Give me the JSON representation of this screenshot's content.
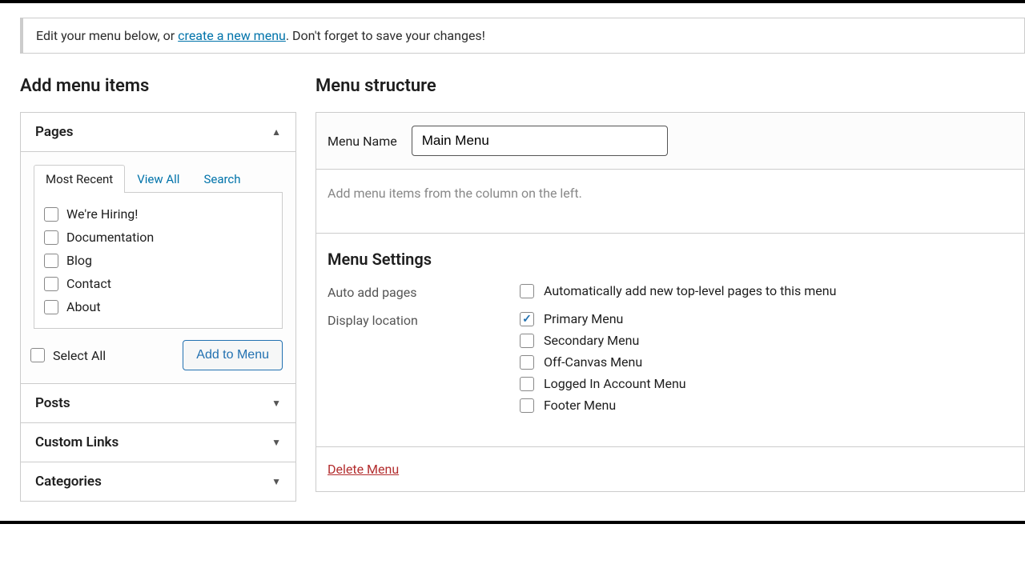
{
  "notice": {
    "prefix": "Edit your menu below, or ",
    "link": "create a new menu",
    "suffix": ". Don't forget to save your changes!"
  },
  "left": {
    "heading": "Add menu items",
    "panels": {
      "pages": {
        "title": "Pages"
      },
      "posts": {
        "title": "Posts"
      },
      "custom_links": {
        "title": "Custom Links"
      },
      "categories": {
        "title": "Categories"
      }
    },
    "tabs": {
      "most_recent": "Most Recent",
      "view_all": "View All",
      "search": "Search"
    },
    "pages_list": [
      "We're Hiring!",
      "Documentation",
      "Blog",
      "Contact",
      "About"
    ],
    "select_all": "Select All",
    "add_to_menu": "Add to Menu"
  },
  "right": {
    "heading": "Menu structure",
    "menu_name_label": "Menu Name",
    "menu_name_value": "Main Menu",
    "empty_msg": "Add menu items from the column on the left.",
    "settings_heading": "Menu Settings",
    "auto_add_label": "Auto add pages",
    "auto_add_option": "Automatically add new top-level pages to this menu",
    "display_location_label": "Display location",
    "locations": [
      {
        "label": "Primary Menu",
        "checked": true
      },
      {
        "label": "Secondary Menu",
        "checked": false
      },
      {
        "label": "Off-Canvas Menu",
        "checked": false
      },
      {
        "label": "Logged In Account Menu",
        "checked": false
      },
      {
        "label": "Footer Menu",
        "checked": false
      }
    ],
    "delete": "Delete Menu"
  }
}
